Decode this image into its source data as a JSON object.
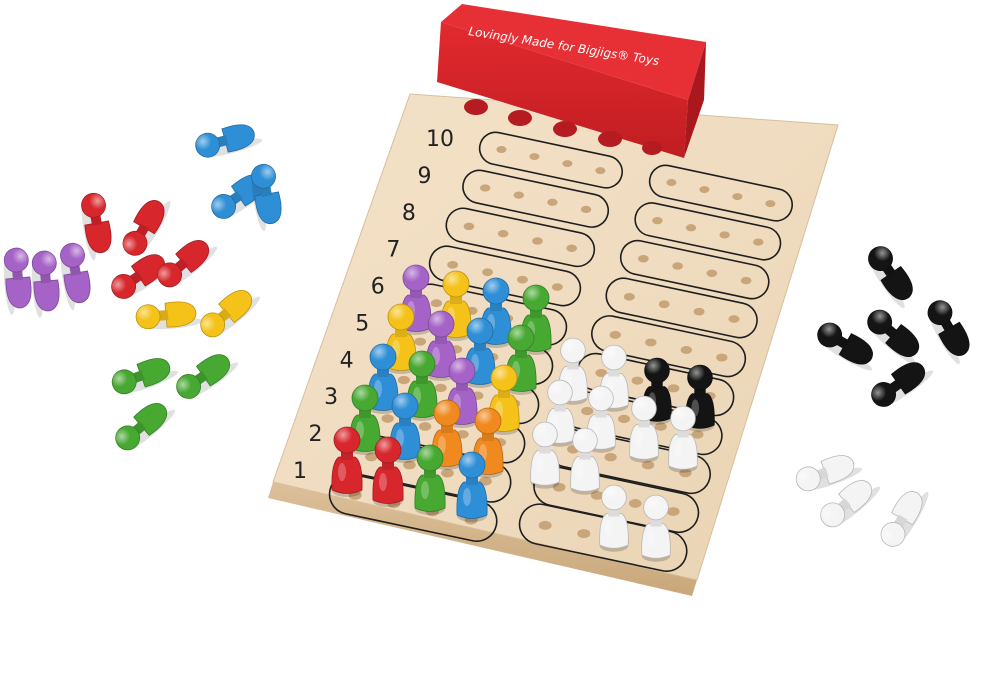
{
  "photo": {
    "subject": "wooden code-breaking peg board game",
    "board": {
      "row_numbers": [
        "1",
        "2",
        "3",
        "4",
        "5",
        "6",
        "7",
        "8",
        "9",
        "10"
      ],
      "holes_per_row": 4
    },
    "code_box": {
      "label": "Lovingly Made for Bigjigs® Toys",
      "color": "#d9252b"
    },
    "peg_colors": {
      "red": "#d7262c",
      "blue": "#2f8fd6",
      "yellow": "#f5c21a",
      "green": "#47a832",
      "purple": "#a562c7",
      "orange": "#f08a1f",
      "white": "#f4f4f4",
      "black": "#141414"
    },
    "guesses": [
      [
        "red",
        "red",
        "green",
        "blue"
      ],
      [
        "green",
        "blue",
        "orange",
        "orange"
      ],
      [
        "blue",
        "green",
        "purple",
        "yellow"
      ],
      [
        "yellow",
        "purple",
        "blue",
        "green"
      ],
      [
        "purple",
        "yellow",
        "blue",
        "green"
      ]
    ],
    "feedback": [
      [
        "white",
        "white",
        "white",
        "white"
      ],
      [
        "white",
        "white",
        "white",
        "white"
      ],
      [
        "white",
        "white",
        "white",
        "white"
      ],
      [
        "white",
        "white",
        "black",
        "black"
      ]
    ]
  }
}
